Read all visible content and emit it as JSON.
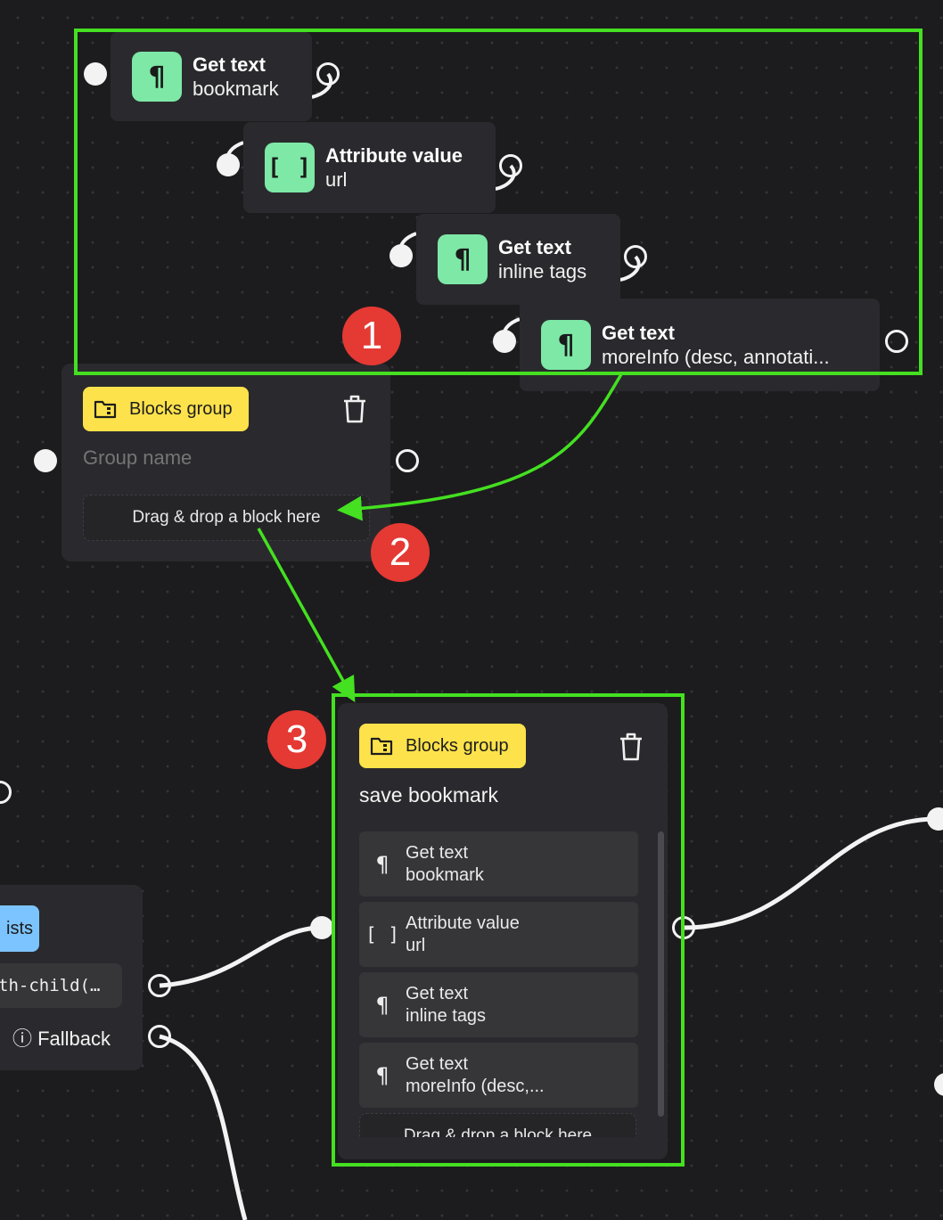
{
  "chain": [
    {
      "title": "Get text",
      "subtitle": "bookmark",
      "icon": "pilcrow-icon",
      "glyph": "¶"
    },
    {
      "title": "Attribute value",
      "subtitle": "url",
      "icon": "brackets-icon",
      "glyph": "[ ]"
    },
    {
      "title": "Get text",
      "subtitle": "inline tags",
      "icon": "pilcrow-icon",
      "glyph": "¶"
    },
    {
      "title": "Get text",
      "subtitle": "moreInfo (desc, annotati...",
      "icon": "pilcrow-icon",
      "glyph": "¶"
    }
  ],
  "group_empty": {
    "badge": "Blocks group",
    "name_placeholder": "Group name",
    "dropzone": "Drag & drop a block here"
  },
  "group_filled": {
    "badge": "Blocks group",
    "name": "save bookmark",
    "items": [
      {
        "glyph": "¶",
        "title": "Get text",
        "subtitle": "bookmark"
      },
      {
        "glyph": "[ ]",
        "title": "Attribute value",
        "subtitle": "url"
      },
      {
        "glyph": "¶",
        "title": "Get text",
        "subtitle": "inline tags"
      },
      {
        "glyph": "¶",
        "title": "Get text",
        "subtitle": "moreInfo (desc,..."
      }
    ],
    "dropzone": "Drag & drop a block here"
  },
  "left_node": {
    "badge": "ists",
    "selector": "th-child(…",
    "fallback": "ⓘ Fallback"
  },
  "step_markers": [
    "1",
    "2",
    "3"
  ],
  "colors": {
    "canvas": "#1c1c1e",
    "node": "#2a2a2e",
    "chip_green": "#7ee8a6",
    "badge_yellow": "#fde24b",
    "badge_blue": "#7cc4ff",
    "highlight": "#44e021",
    "marker_red": "#e53934"
  }
}
